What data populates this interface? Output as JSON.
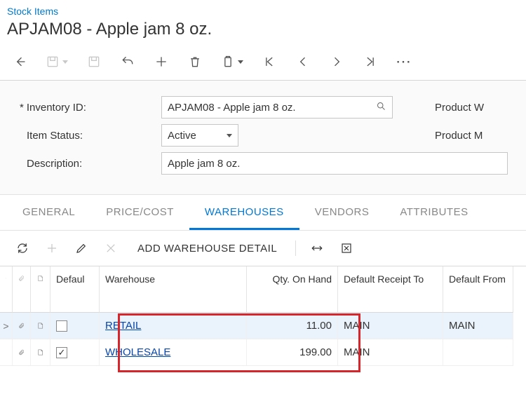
{
  "breadcrumb": "Stock Items",
  "page_title": "APJAM08 - Apple jam 8 oz.",
  "form": {
    "inventory_id_label": "Inventory ID:",
    "inventory_id_value": "APJAM08 - Apple jam 8 oz.",
    "item_status_label": "Item Status:",
    "item_status_value": "Active",
    "description_label": "Description:",
    "description_value": "Apple jam 8 oz.",
    "right_label_1": "Product W",
    "right_label_2": "Product M"
  },
  "tabs": {
    "general": "GENERAL",
    "price_cost": "PRICE/COST",
    "warehouses": "WAREHOUSES",
    "vendors": "VENDORS",
    "attributes": "ATTRIBUTES"
  },
  "grid_toolbar": {
    "add_detail": "ADD WAREHOUSE DETAIL"
  },
  "grid": {
    "headers": {
      "default": "Defaul",
      "warehouse": "Warehouse",
      "qty_on_hand": "Qty. On Hand",
      "default_receipt_to": "Default Receipt To",
      "default_issue_from": "Default From"
    },
    "rows": [
      {
        "selected": true,
        "default_checked": false,
        "warehouse": "RETAIL",
        "qty": "11.00",
        "receipt_to": "MAIN",
        "issue_from": "MAIN"
      },
      {
        "selected": false,
        "default_checked": true,
        "warehouse": "WHOLESALE",
        "qty": "199.00",
        "receipt_to": "MAIN",
        "issue_from": ""
      }
    ]
  }
}
